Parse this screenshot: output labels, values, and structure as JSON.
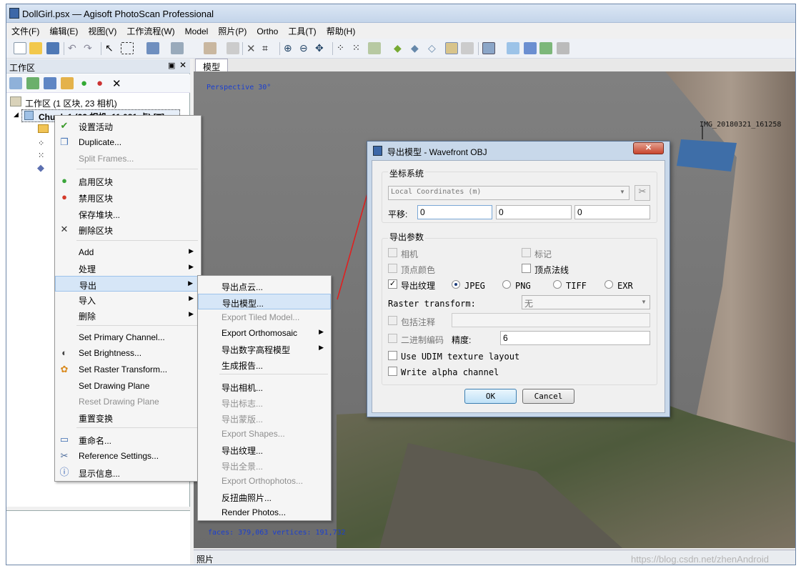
{
  "window": {
    "title": "DollGirl.psx — Agisoft PhotoScan Professional"
  },
  "menubar": [
    "文件(F)",
    "编辑(E)",
    "视图(V)",
    "工作流程(W)",
    "Model",
    "照片(P)",
    "Ortho",
    "工具(T)",
    "帮助(H)"
  ],
  "workspace": {
    "header": "工作区",
    "root": "工作区 (1 区块, 23 相机)",
    "chunk": "Chunk 1 (23 相机, 11,081 点) [T]"
  },
  "view": {
    "tab": "模型",
    "perspective": "Perspective 30°",
    "camera_label": "IMG_20180321_161258",
    "stats": "faces: 379,063 vertices: 191,732"
  },
  "photos_pane": {
    "label": "照片"
  },
  "watermark": "https://blog.csdn.net/zhenAndroid",
  "context_menu": {
    "items": [
      {
        "label": "设置活动",
        "icon": "check-icon",
        "enabled": true
      },
      {
        "label": "Duplicate...",
        "icon": "duplicate-icon",
        "enabled": true
      },
      {
        "label": "Split Frames...",
        "icon": "",
        "enabled": false
      },
      {
        "label": "启用区块",
        "icon": "enable-icon",
        "enabled": true
      },
      {
        "label": "禁用区块",
        "icon": "disable-icon",
        "enabled": true
      },
      {
        "label": "保存堆块...",
        "icon": "",
        "enabled": true
      },
      {
        "label": "删除区块",
        "icon": "delete-icon",
        "enabled": true
      },
      {
        "label": "Add",
        "icon": "",
        "enabled": true,
        "sub": true
      },
      {
        "label": "处理",
        "icon": "",
        "enabled": true,
        "sub": true
      },
      {
        "label": "导出",
        "icon": "",
        "enabled": true,
        "sub": true,
        "highlight": true
      },
      {
        "label": "导入",
        "icon": "",
        "enabled": true,
        "sub": true
      },
      {
        "label": "删除",
        "icon": "",
        "enabled": true,
        "sub": true
      },
      {
        "label": "Set Primary Channel...",
        "icon": "",
        "enabled": true
      },
      {
        "label": "Set Brightness...",
        "icon": "brightness-icon",
        "enabled": true
      },
      {
        "label": "Set Raster Transform...",
        "icon": "palette-icon",
        "enabled": true
      },
      {
        "label": "Set Drawing Plane",
        "icon": "",
        "enabled": true
      },
      {
        "label": "Reset Drawing Plane",
        "icon": "",
        "enabled": false
      },
      {
        "label": "重置变换",
        "icon": "",
        "enabled": true
      },
      {
        "label": "重命名...",
        "icon": "rename-icon",
        "enabled": true
      },
      {
        "label": "Reference Settings...",
        "icon": "settings-icon",
        "enabled": true
      },
      {
        "label": "显示信息...",
        "icon": "info-icon",
        "enabled": true
      }
    ]
  },
  "export_submenu": {
    "items": [
      {
        "label": "导出点云...",
        "enabled": true
      },
      {
        "label": "导出模型...",
        "enabled": true,
        "highlight": true
      },
      {
        "label": "Export Tiled Model...",
        "enabled": false
      },
      {
        "label": "Export Orthomosaic",
        "enabled": true,
        "sub": true
      },
      {
        "label": "导出数字高程模型",
        "enabled": true,
        "sub": true
      },
      {
        "label": "生成报告...",
        "enabled": true
      },
      {
        "label": "导出相机...",
        "enabled": true
      },
      {
        "label": "导出标志...",
        "enabled": false
      },
      {
        "label": "导出蒙版...",
        "enabled": false
      },
      {
        "label": "Export Shapes...",
        "enabled": false
      },
      {
        "label": "导出纹理...",
        "enabled": true
      },
      {
        "label": "导出全景...",
        "enabled": false
      },
      {
        "label": "Export Orthophotos...",
        "enabled": false
      },
      {
        "label": "反扭曲照片...",
        "enabled": true
      },
      {
        "label": "Render Photos...",
        "enabled": true
      }
    ]
  },
  "dialog": {
    "title": "导出模型 - Wavefront OBJ",
    "coord_group": "坐标系统",
    "coord_value": "Local Coordinates (m)",
    "shift_label": "平移:",
    "shift": [
      "0",
      "0",
      "0"
    ],
    "params_group": "导出参数",
    "cameras": "相机",
    "markers": "标记",
    "vertex_colors": "顶点颜色",
    "vertex_normals": "顶点法线",
    "export_texture": "导出纹理",
    "formats": [
      "JPEG",
      "PNG",
      "TIFF",
      "EXR"
    ],
    "raster_label": "Raster transform:",
    "raster_value": "无",
    "include_comment": "包括注释",
    "binary": "二进制编码",
    "precision_label": "精度:",
    "precision": "6",
    "udim": "Use UDIM texture layout",
    "alpha": "Write alpha channel",
    "ok": "OK",
    "cancel": "Cancel"
  }
}
